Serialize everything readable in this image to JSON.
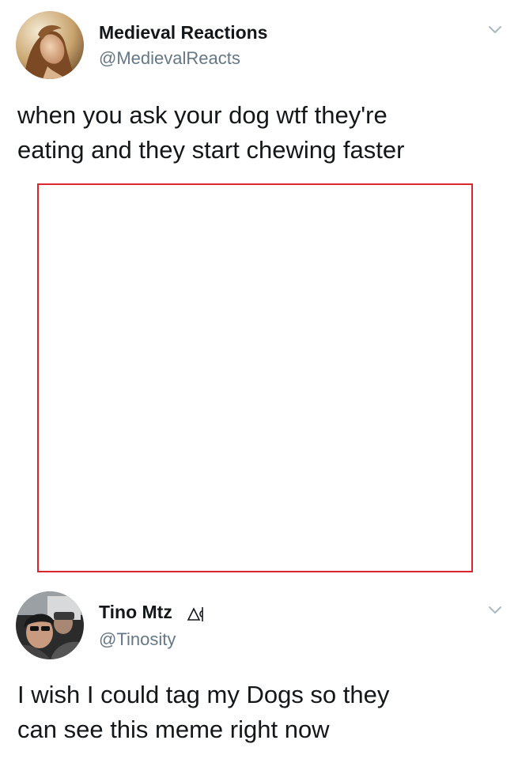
{
  "tweet1": {
    "display_name": "Medieval Reactions",
    "handle": "@MedievalReacts",
    "text": "when you ask your dog wtf they're\neating and they start chewing faster"
  },
  "tweet2": {
    "display_name": "Tino Mtz",
    "handle": "@Tinosity",
    "text": "I wish I could tag my Dogs so they\ncan see this meme right now"
  },
  "icons": {
    "menu": "chevron-down-icon",
    "badge": "triangle-symbol-icon"
  },
  "colors": {
    "text": "#14171a",
    "handle": "#657786",
    "media_border": "#d9262c",
    "chevron": "#aab8c2"
  }
}
